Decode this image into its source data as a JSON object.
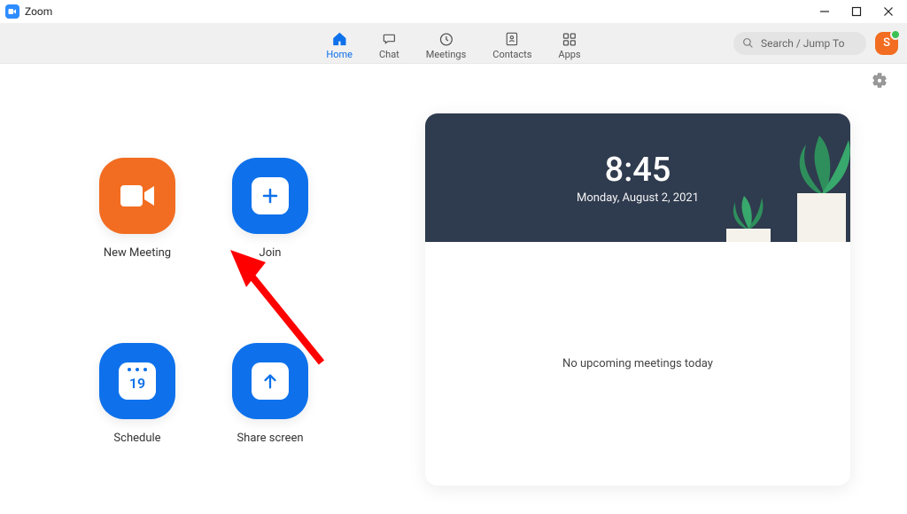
{
  "window": {
    "title": "Zoom"
  },
  "nav": {
    "tabs": [
      {
        "label": "Home"
      },
      {
        "label": "Chat"
      },
      {
        "label": "Meetings"
      },
      {
        "label": "Contacts"
      },
      {
        "label": "Apps"
      }
    ]
  },
  "search": {
    "placeholder": "Search / Jump To"
  },
  "profile": {
    "initial": "S"
  },
  "actions": {
    "new_meeting": "New Meeting",
    "join": "Join",
    "schedule": "Schedule",
    "schedule_day": "19",
    "share_screen": "Share screen"
  },
  "clock": {
    "time": "8:45",
    "date": "Monday, August 2, 2021"
  },
  "meetings": {
    "empty_text": "No upcoming meetings today"
  },
  "colors": {
    "accent_orange": "#F26D21",
    "accent_blue": "#0e71eb"
  }
}
